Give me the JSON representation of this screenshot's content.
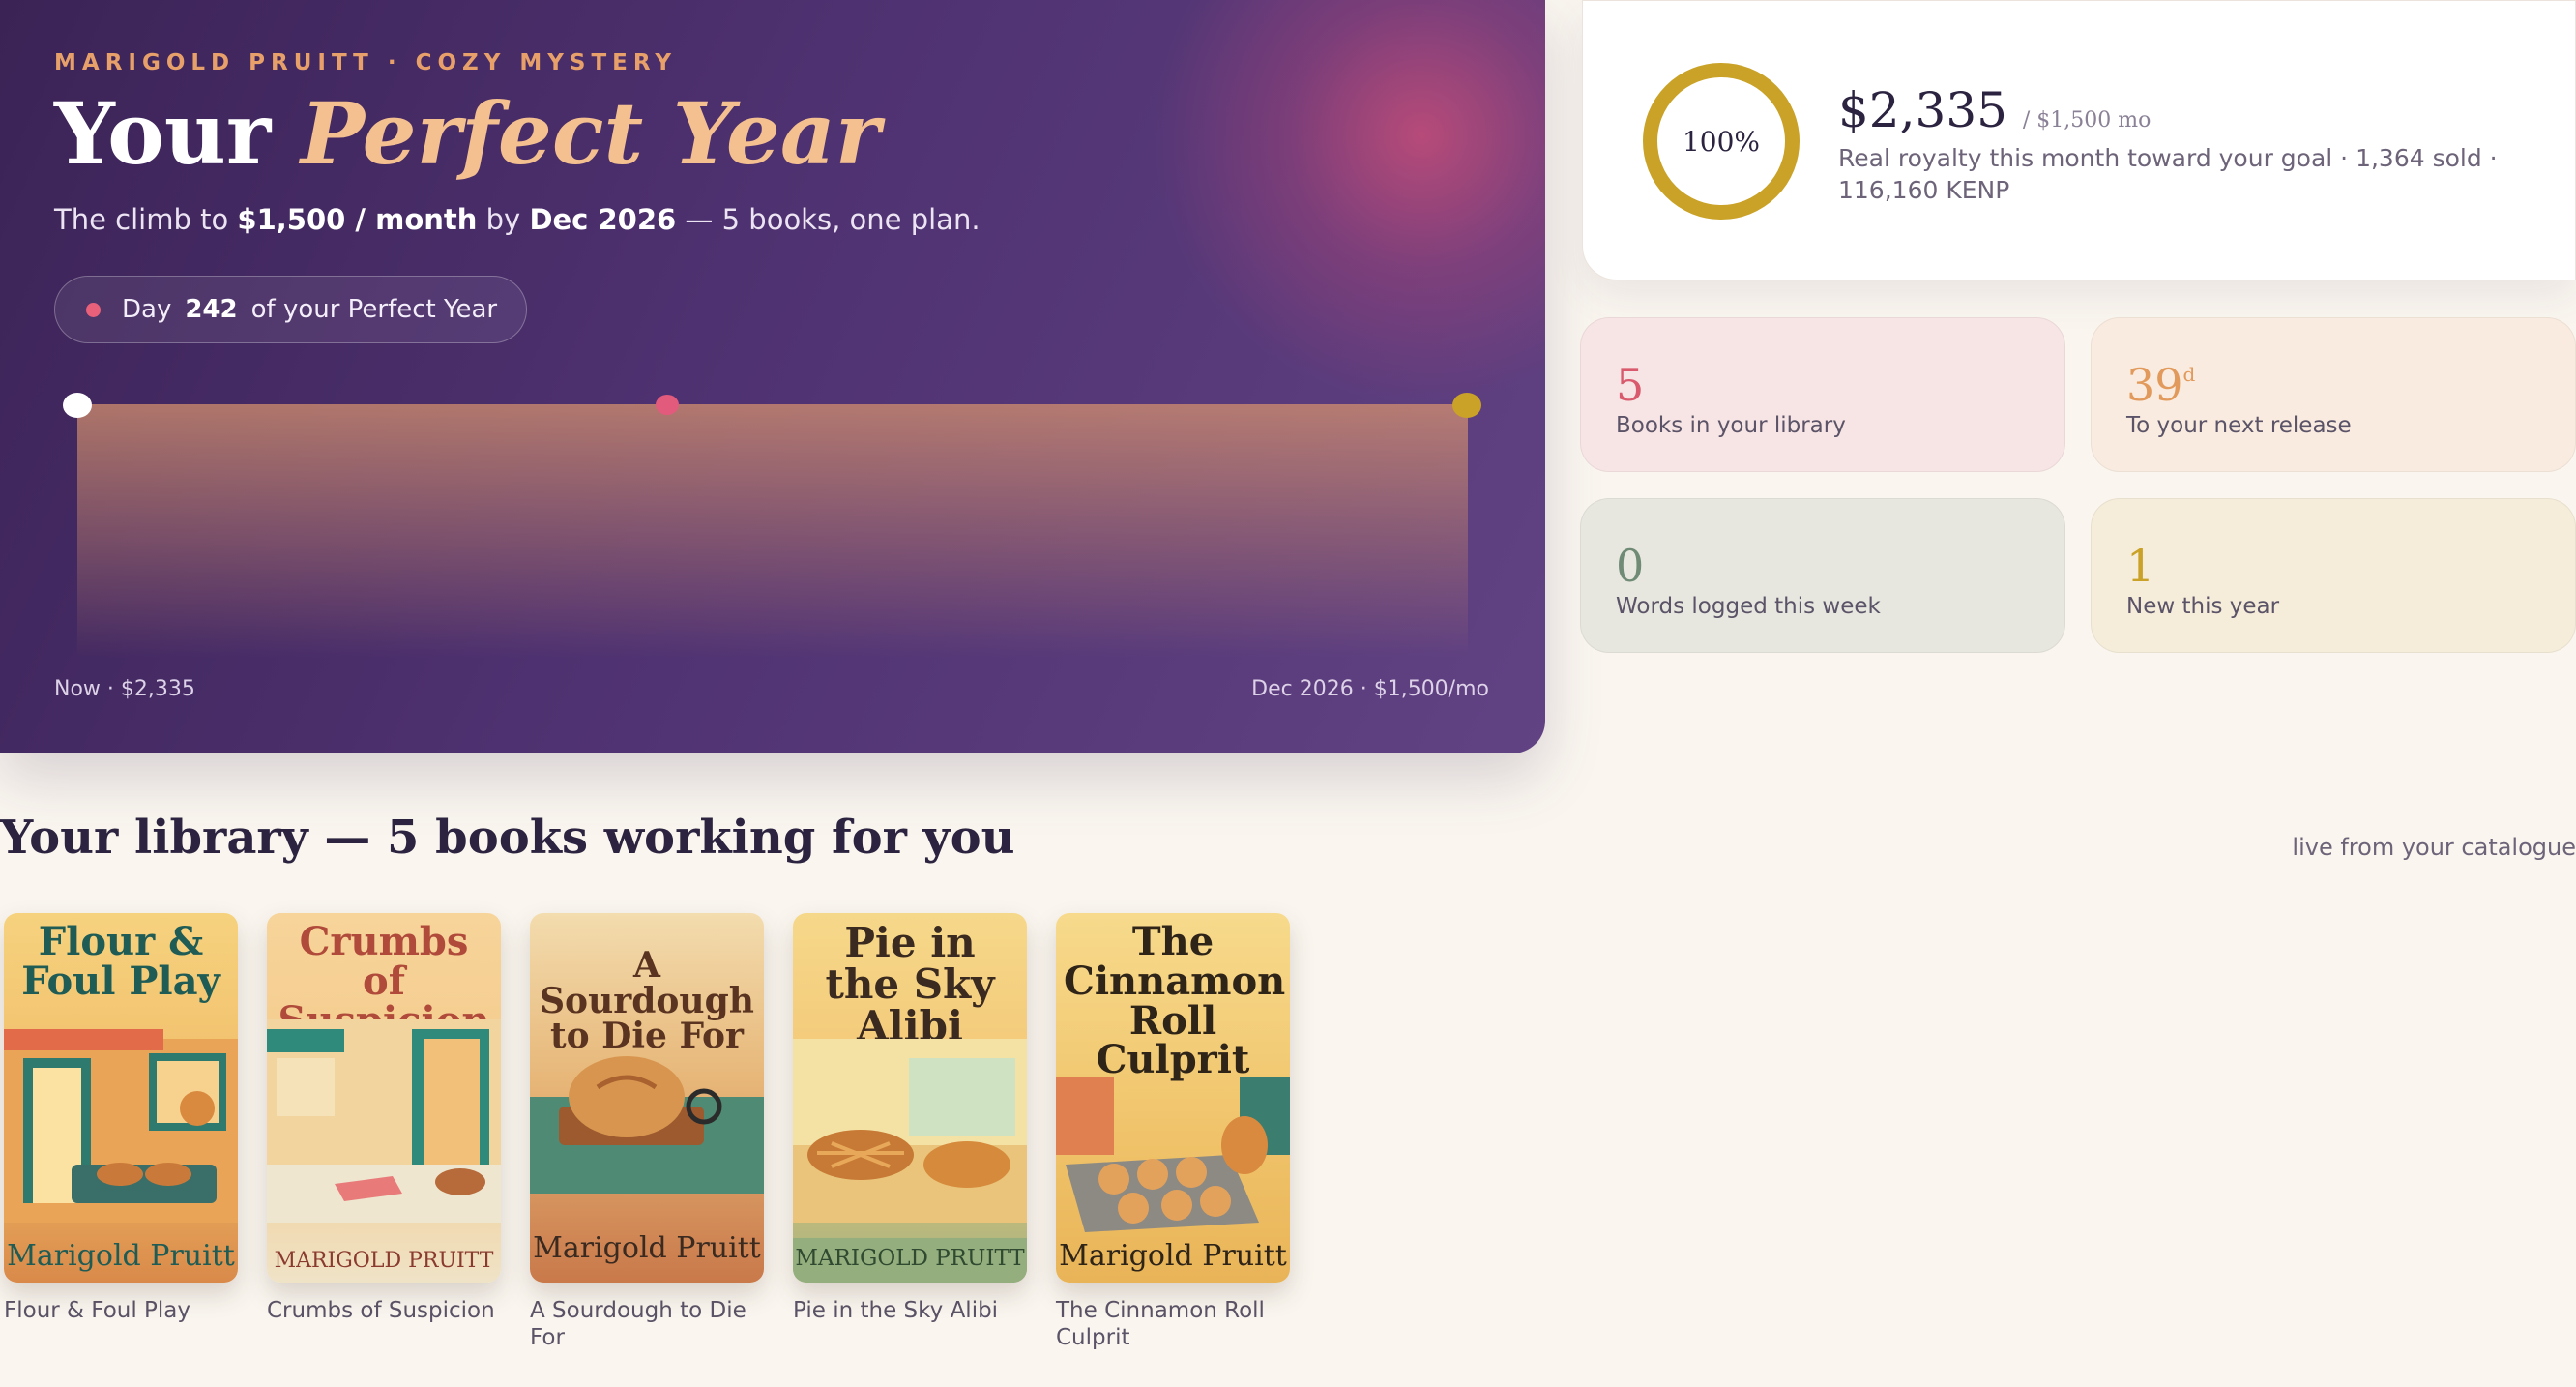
{
  "hero": {
    "eyebrow": "MARIGOLD PRUITT · COZY MYSTERY",
    "title_plain": "Your ",
    "title_accent": "Perfect Year",
    "sub_pre": "The climb to ",
    "sub_goal": "$1,500 / month",
    "sub_mid": " by ",
    "sub_date": "Dec 2026",
    "sub_post": " — 5 books, one plan.",
    "day_label": "Day",
    "day_number": "242",
    "day_suffix": "of your Perfect Year",
    "progress_now_fraction": 0.42,
    "label_now": "Now · $2,335",
    "label_end": "Dec 2026 · $1,500/mo"
  },
  "goal": {
    "percent": "100%",
    "amount": "$2,335",
    "target": "/ $1,500 mo",
    "description": "Real royalty this month toward your goal · 1,364 sold · 116,160 KENP"
  },
  "stats": [
    {
      "value": "5",
      "unit": "",
      "label": "Books in your library"
    },
    {
      "value": "39",
      "unit": "d",
      "label": "To your next release"
    },
    {
      "value": "0",
      "unit": "",
      "label": "Words logged this week"
    },
    {
      "value": "1",
      "unit": "",
      "label": "New this year"
    }
  ],
  "library": {
    "title": "Your library — 5 books working for you",
    "note": "live from your catalogue",
    "books": [
      {
        "cover_title": "Flour & Foul Play",
        "cover_author": "Marigold Pruitt",
        "title": "Flour & Foul Play"
      },
      {
        "cover_title": "Crumbs of Suspicion",
        "cover_author": "MARIGOLD PRUITT",
        "title": "Crumbs of Suspicion"
      },
      {
        "cover_title": "A Sourdough to Die For",
        "cover_author": "Marigold Pruitt",
        "title": "A Sourdough to Die For"
      },
      {
        "cover_title": "Pie in the Sky Alibi",
        "cover_author": "MARIGOLD PRUITT",
        "title": "Pie in the Sky Alibi"
      },
      {
        "cover_title": "The Cinnamon Roll Culprit",
        "cover_author": "Marigold Pruitt",
        "title": "The Cinnamon Roll Culprit"
      }
    ]
  },
  "colors": {
    "accent_gold": "#c9a227",
    "accent_rose": "#e25a7c",
    "hero_purple": "#4e3170"
  }
}
